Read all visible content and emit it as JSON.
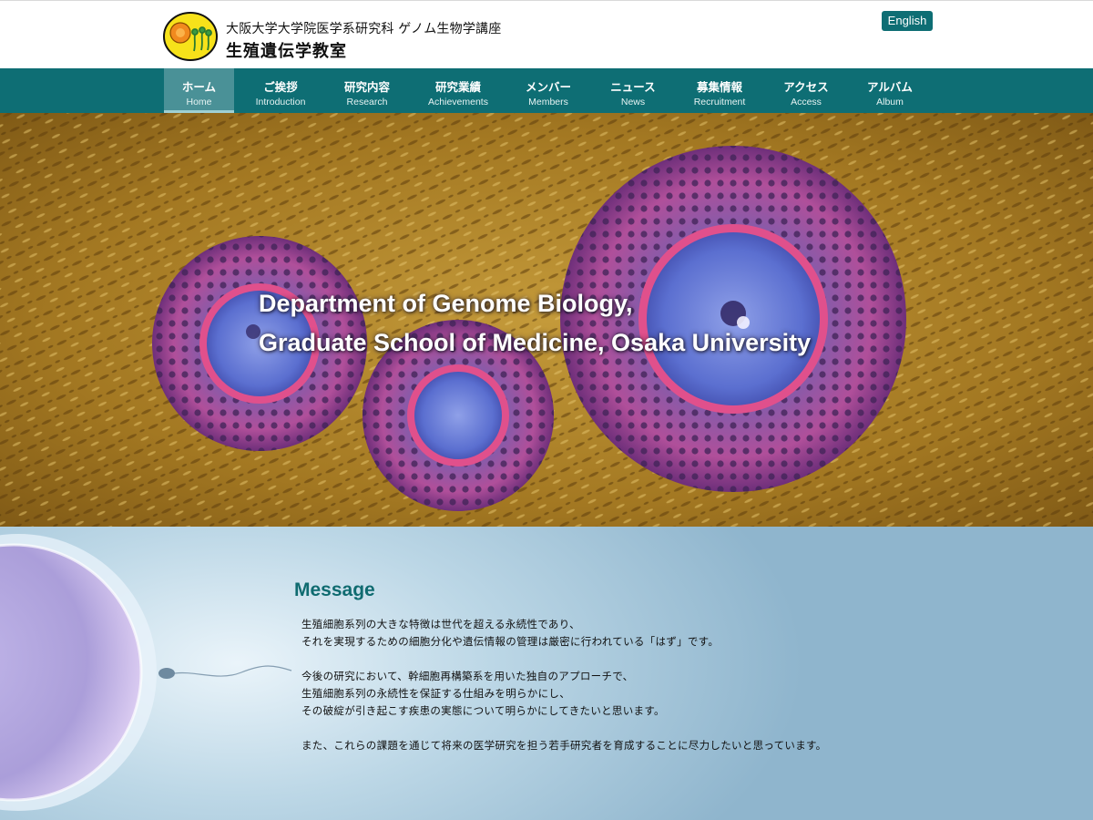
{
  "header": {
    "org_line": "大阪大学大学院医学系研究科 ゲノム生物学講座",
    "lab_name": "生殖遺伝学教室",
    "language_button": "English"
  },
  "nav": {
    "items": [
      {
        "jp": "ホーム",
        "en": "Home",
        "active": true
      },
      {
        "jp": "ご挨拶",
        "en": "Introduction"
      },
      {
        "jp": "研究内容",
        "en": "Research"
      },
      {
        "jp": "研究業績",
        "en": "Achievements"
      },
      {
        "jp": "メンバー",
        "en": "Members"
      },
      {
        "jp": "ニュース",
        "en": "News"
      },
      {
        "jp": "募集情報",
        "en": "Recruitment"
      },
      {
        "jp": "アクセス",
        "en": "Access"
      },
      {
        "jp": "アルバム",
        "en": "Album"
      }
    ]
  },
  "hero": {
    "title_line1": "Department of Genome Biology,",
    "title_line2": "Graduate School of Medicine, Osaka University"
  },
  "message": {
    "heading": "Message",
    "paragraphs": [
      [
        "生殖細胞系列の大きな特徴は世代を超える永続性であり、",
        "それを実現するための細胞分化や遺伝情報の管理は厳密に行われている「はず」です。"
      ],
      [
        "今後の研究において、幹細胞再構築系を用いた独自のアプローチで、",
        "生殖細胞系列の永続性を保証する仕組みを明らかにし、",
        "その破綻が引き起こす疾患の実態について明らかにしてきたいと思います。"
      ],
      [
        "また、これらの課題を通じて将来の医学研究を担う若手研究者を育成することに尽力したいと思っています。"
      ]
    ]
  },
  "colors": {
    "brand_teal": "#0e6e74",
    "nav_active": "#4a9197",
    "heading_teal": "#0f6b70"
  }
}
